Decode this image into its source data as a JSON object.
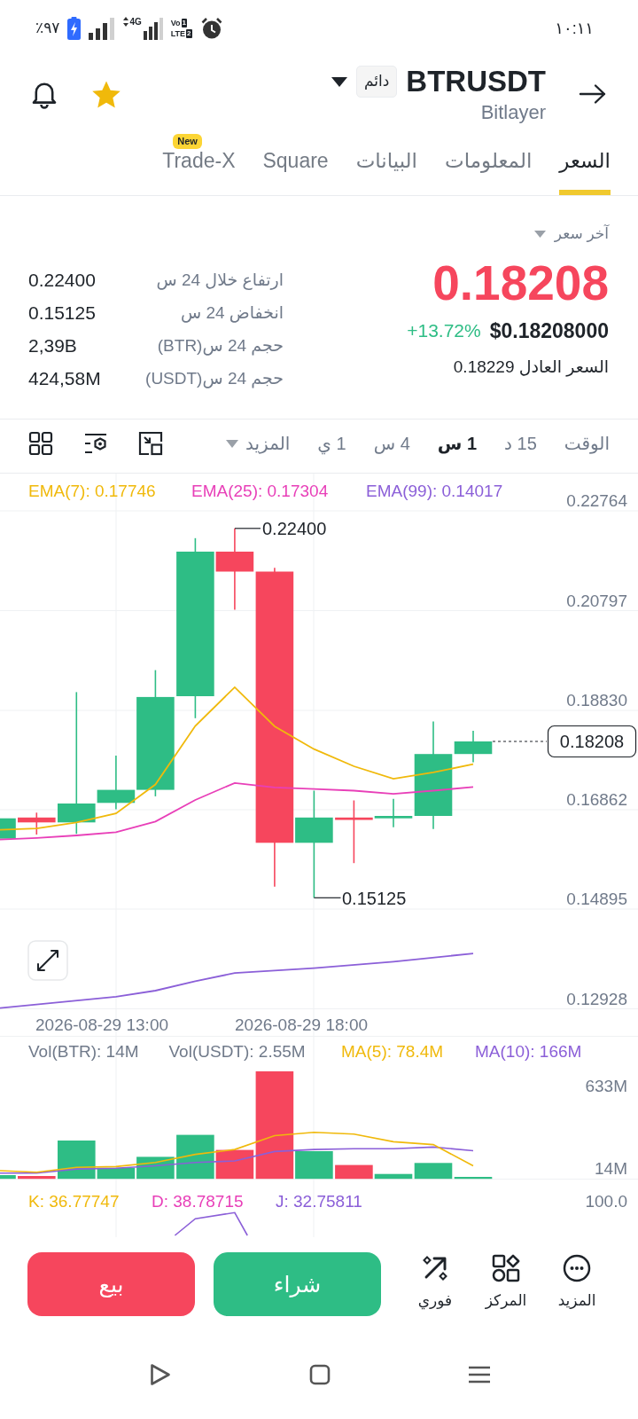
{
  "status_bar": {
    "battery": "٪٩٧",
    "network": "4G",
    "volte": {
      "top": "Vo",
      "bottom": "LTE",
      "slots": [
        "1",
        "2"
      ]
    },
    "time": "١٠:١١"
  },
  "header": {
    "favorite": true,
    "badge": "دائم",
    "symbol": "BTRUSDT",
    "subtitle": "Bitlayer"
  },
  "tabs": [
    {
      "label": "السعر",
      "selected": true
    },
    {
      "label": "المعلومات",
      "selected": false
    },
    {
      "label": "البيانات",
      "selected": false
    },
    {
      "label": "Square",
      "selected": false
    },
    {
      "badge": "New",
      "label": "Trade-X",
      "selected": false
    }
  ],
  "price": {
    "caption": "آخر سعر",
    "last": "0.18208",
    "usd": "$0.18208000",
    "change": "+13.72%",
    "fair": "السعر العادل 0.18229"
  },
  "stats": [
    {
      "label": "ارتفاع خلال 24 س",
      "value": "0.22400"
    },
    {
      "label": "انخفاض 24 س",
      "value": "0.15125"
    },
    {
      "label": "حجم 24 س(BTR)",
      "value": "2,39B"
    },
    {
      "label": "حجم 24 س(USDT)",
      "value": "424,58M"
    }
  ],
  "intervals": {
    "items": [
      {
        "label": "الوقت",
        "selected": false
      },
      {
        "label": "15 د",
        "selected": false
      },
      {
        "label": "1 س",
        "selected": true
      },
      {
        "label": "4 س",
        "selected": false
      },
      {
        "label": "1 ي",
        "selected": false
      }
    ],
    "more": "المزيد"
  },
  "price_chart": {
    "legend": [
      {
        "text": "EMA(99): 0.14017",
        "color": "#8b5fd8"
      },
      {
        "text": "EMA(25): 0.17304",
        "color": "#e83fb8"
      },
      {
        "text": "EMA(7): 0.17746",
        "color": "#f0b90b"
      }
    ],
    "axis": [
      "0.22764",
      "0.20797",
      "0.18830",
      "0.16862",
      "0.14895",
      "0.12928"
    ],
    "high": "0.22400",
    "low": "0.15125",
    "last": "0.18208",
    "times": [
      "2026-08-29 18:00",
      "2026-08-29 13:00"
    ]
  },
  "volume_chart": {
    "legend": [
      {
        "text": "MA(10): 166M",
        "color": "#8b5fd8"
      },
      {
        "text": "MA(5): 78.4M",
        "color": "#f0b90b"
      },
      {
        "text": "Vol(USDT): 2.55M",
        "color": "#707a8a"
      },
      {
        "text": "Vol(BTR): 14M",
        "color": "#707a8a"
      }
    ],
    "axis": [
      "633M",
      "14M"
    ]
  },
  "kdj_chart": {
    "legend": [
      {
        "text": "J: 32.75811",
        "color": "#8b5fd8"
      },
      {
        "text": "D: 38.78715",
        "color": "#e83fb8"
      },
      {
        "text": "K: 36.77747",
        "color": "#f0b90b"
      }
    ],
    "axis": [
      "100.0"
    ]
  },
  "actions": [
    {
      "label": "المزيد",
      "kind": "more"
    },
    {
      "label": "المركز",
      "kind": "shapes"
    },
    {
      "label": "فوري",
      "kind": "convert"
    }
  ],
  "trade": [
    {
      "label": "شراء",
      "kind": "buy"
    },
    {
      "label": "بيع",
      "kind": "sell"
    }
  ]
}
